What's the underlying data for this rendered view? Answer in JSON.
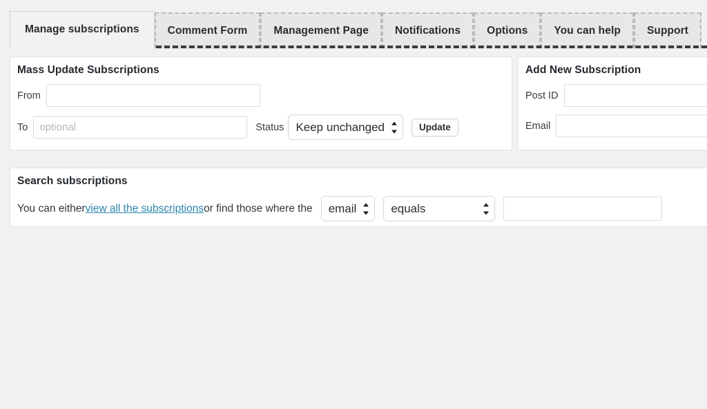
{
  "tabs": [
    {
      "label": "Manage subscriptions",
      "active": true
    },
    {
      "label": "Comment Form",
      "active": false
    },
    {
      "label": "Management Page",
      "active": false
    },
    {
      "label": "Notifications",
      "active": false
    },
    {
      "label": "Options",
      "active": false
    },
    {
      "label": "You can help",
      "active": false
    },
    {
      "label": "Support",
      "active": false
    }
  ],
  "mass_update": {
    "title": "Mass Update Subscriptions",
    "from_label": "From",
    "from_value": "",
    "from_placeholder": "",
    "to_label": "To",
    "to_value": "",
    "to_placeholder": "optional",
    "status_label": "Status",
    "status_value": "Keep unchanged",
    "status_options": [
      "Keep unchanged"
    ],
    "update_button": "Update"
  },
  "add_new": {
    "title": "Add New Subscription",
    "post_id_label": "Post ID",
    "post_id_value": "",
    "email_label": "Email",
    "email_value": ""
  },
  "search": {
    "title": "Search subscriptions",
    "text_before_link": "You can either ",
    "link_label": "view all the subscriptions",
    "text_after_link": " or find those where the",
    "field_value": "email",
    "field_options": [
      "email"
    ],
    "operator_value": "equals",
    "operator_options": [
      "equals"
    ],
    "value_input": "",
    "value_placeholder": ""
  },
  "colors": {
    "background": "#f1f1f1",
    "panel": "#ffffff",
    "panel_border": "#e2e2e2",
    "tab_inactive_bg": "#e7e7e7",
    "tab_dashed_border": "#b9b9b9",
    "tab_underline": "#3c3c3c",
    "link": "#2a85a8",
    "text": "#32373c",
    "placeholder": "#b6b6b6"
  }
}
